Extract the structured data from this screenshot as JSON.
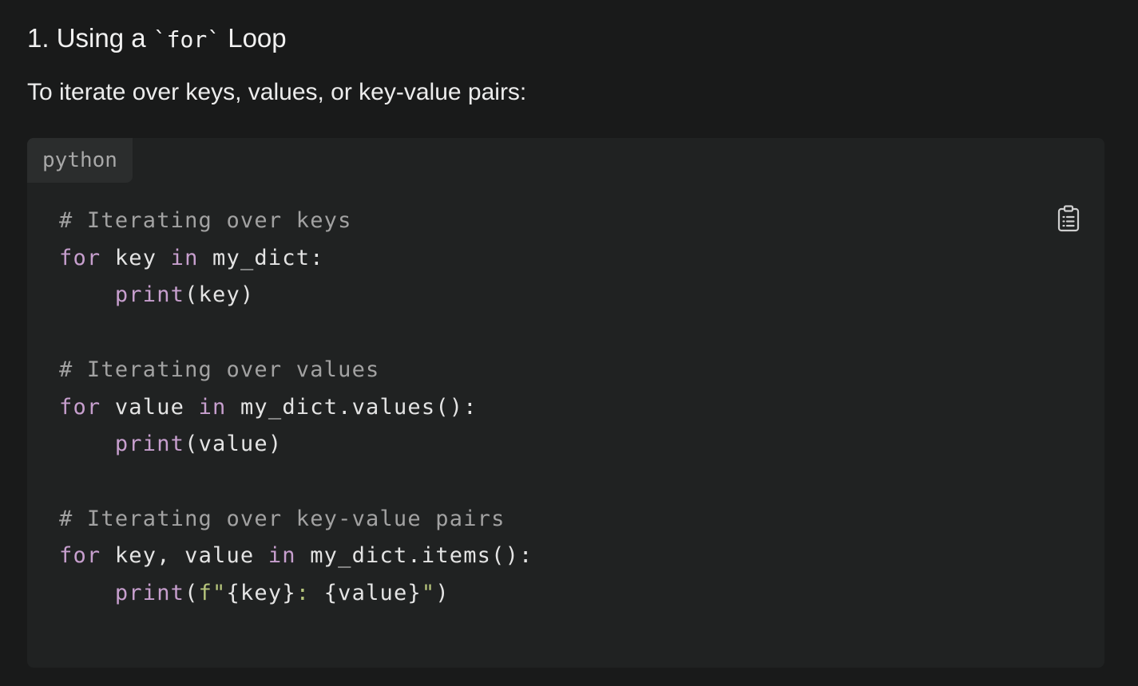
{
  "heading": {
    "prefix": "1. Using a ",
    "code": "`for`",
    "suffix": " Loop"
  },
  "intro": "To iterate over keys, values, or key-value pairs:",
  "code_block": {
    "language": "python",
    "copy_icon": "clipboard-icon",
    "lines": [
      [
        {
          "t": "comment",
          "v": "# Iterating over keys"
        }
      ],
      [
        {
          "t": "kw",
          "v": "for"
        },
        {
          "t": "plain",
          "v": " key "
        },
        {
          "t": "kw",
          "v": "in"
        },
        {
          "t": "plain",
          "v": " my_dict:"
        }
      ],
      [
        {
          "t": "plain",
          "v": "    "
        },
        {
          "t": "kw",
          "v": "print"
        },
        {
          "t": "plain",
          "v": "(key)"
        }
      ],
      [
        {
          "t": "plain",
          "v": ""
        }
      ],
      [
        {
          "t": "comment",
          "v": "# Iterating over values"
        }
      ],
      [
        {
          "t": "kw",
          "v": "for"
        },
        {
          "t": "plain",
          "v": " value "
        },
        {
          "t": "kw",
          "v": "in"
        },
        {
          "t": "plain",
          "v": " my_dict.values():"
        }
      ],
      [
        {
          "t": "plain",
          "v": "    "
        },
        {
          "t": "kw",
          "v": "print"
        },
        {
          "t": "plain",
          "v": "(value)"
        }
      ],
      [
        {
          "t": "plain",
          "v": ""
        }
      ],
      [
        {
          "t": "comment",
          "v": "# Iterating over key-value pairs"
        }
      ],
      [
        {
          "t": "kw",
          "v": "for"
        },
        {
          "t": "plain",
          "v": " key, value "
        },
        {
          "t": "kw",
          "v": "in"
        },
        {
          "t": "plain",
          "v": " my_dict.items():"
        }
      ],
      [
        {
          "t": "plain",
          "v": "    "
        },
        {
          "t": "kw",
          "v": "print"
        },
        {
          "t": "plain",
          "v": "("
        },
        {
          "t": "str",
          "v": "f\""
        },
        {
          "t": "plain",
          "v": "{key}"
        },
        {
          "t": "str",
          "v": ": "
        },
        {
          "t": "plain",
          "v": "{value}"
        },
        {
          "t": "str",
          "v": "\""
        },
        {
          "t": "plain",
          "v": ")"
        }
      ]
    ]
  },
  "colors": {
    "background": "#191a1a",
    "code_background": "#202222",
    "keyword": "#c79fce",
    "comment": "#a2a2a2",
    "string": "#b6c57c"
  }
}
